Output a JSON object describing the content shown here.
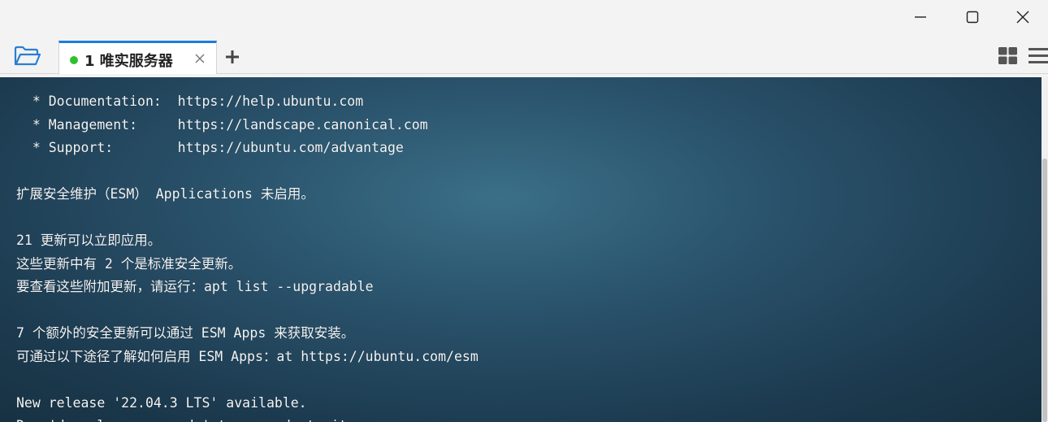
{
  "window": {
    "minimize_icon": "minimize-icon",
    "maximize_icon": "maximize-icon",
    "close_icon": "close-icon"
  },
  "tabbar": {
    "folder_icon": "folder-open-icon",
    "tabs": [
      {
        "label": "1 唯实服务器",
        "status_color": "#2fc12f",
        "active": true
      }
    ],
    "add_icon": "plus-icon",
    "layout_icon": "grid-icon",
    "menu_icon": "hamburger-icon",
    "accent_color": "#1a7fd6"
  },
  "terminal": {
    "lines": [
      "  * Documentation:  https://help.ubuntu.com",
      "  * Management:     https://landscape.canonical.com",
      "  * Support:        https://ubuntu.com/advantage",
      "",
      "扩展安全维护（ESM） Applications 未启用。",
      "",
      "21 更新可以立即应用。",
      "这些更新中有 2 个是标准安全更新。",
      "要查看这些附加更新，请运行：apt list --upgradable",
      "",
      "7 个额外的安全更新可以通过 ESM Apps 来获取安装。",
      "可通过以下途径了解如何启用 ESM Apps：at https://ubuntu.com/esm",
      "",
      "New release '22.04.3 LTS' available.",
      "Run 'do-release-upgrade' to upgrade to it."
    ]
  }
}
